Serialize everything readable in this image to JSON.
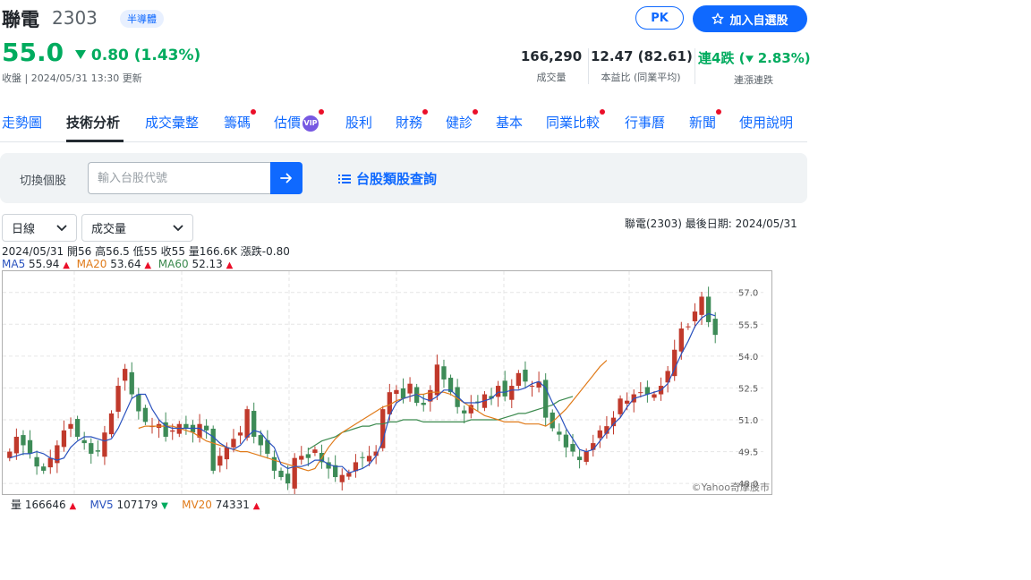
{
  "header": {
    "name": "聯電",
    "code": "2303",
    "industry": "半導體",
    "price": "55.0",
    "change": "0.80 (1.43%)",
    "meta": "收盤 | 2024/05/31 13:30 更新",
    "pk_label": "PK",
    "watchlist_label": "加入自選股"
  },
  "stats": [
    {
      "value": "166,290",
      "label": "成交量"
    },
    {
      "value": "12.47 (82.61)",
      "label": "本益比 (同業平均)"
    },
    {
      "value_prefix": "連4跌 (",
      "value_num": "2.83%",
      "value_suffix": ")",
      "label": "連漲連跌"
    }
  ],
  "tabs": [
    "走勢圖",
    "技術分析",
    "成交彙整",
    "籌碼",
    "估價",
    "股利",
    "財務",
    "健診",
    "基本",
    "同業比較",
    "行事曆",
    "新聞",
    "使用說明"
  ],
  "vip_label": "VIP",
  "search": {
    "label": "切換個股",
    "placeholder": "輸入台股代號",
    "category_link": "台股類股查詢"
  },
  "controls": {
    "period": "日線",
    "indicator": "成交量",
    "last_date": "聯電(2303)   最後日期: 2024/05/31"
  },
  "ohlc_text": "2024/05/31 開56 高56.5 低55 收55 量166.6K 漲跌-0.80",
  "ma": [
    {
      "label": "MA5",
      "value": "55.94",
      "color": "#2a52be"
    },
    {
      "label": "MA20",
      "value": "53.64",
      "color": "#e07b1a"
    },
    {
      "label": "MA60",
      "value": "52.13",
      "color": "#3b8a4e"
    }
  ],
  "volume": [
    {
      "label": "量",
      "value": "166646",
      "dir": "up",
      "color": "#232a31"
    },
    {
      "label": "MV5",
      "value": "107179",
      "dir": "down",
      "color": "#2a52be"
    },
    {
      "label": "MV20",
      "value": "74331",
      "dir": "up",
      "color": "#e07b1a"
    }
  ],
  "colors": {
    "accent": "#0f69ff",
    "up": "#eb0f29",
    "down": "#00ab5e",
    "candle_up": "#c0392b",
    "candle_down": "#3d8b57"
  },
  "chart_data": {
    "type": "candlestick",
    "y_ticks": [
      "57.0",
      "55.5",
      "54.0",
      "52.5",
      "51.0",
      "49.5",
      "48.0"
    ],
    "ylim": [
      47.5,
      58.0
    ],
    "watermark": "©Yahoo奇摩股市",
    "closes": [
      49.5,
      50.2,
      49.8,
      49.4,
      48.8,
      48.6,
      49.2,
      49.8,
      50.5,
      50.8,
      50.2,
      49.9,
      49.4,
      49.5,
      50.4,
      51.3,
      52.6,
      53.4,
      52.2,
      51.4,
      50.9,
      50.7,
      50.8,
      50.2,
      50.5,
      50.8,
      50.6,
      50.4,
      50.8,
      50.5,
      48.6,
      49.3,
      49.7,
      50.1,
      50.4,
      51.5,
      50.2,
      49.8,
      49.4,
      48.6,
      48.3,
      48.0,
      49.2,
      49.3,
      49.2,
      49.6,
      49.0,
      48.7,
      48.3,
      48.4,
      48.5,
      49.0,
      49.2,
      49.3,
      49.5,
      51.5,
      52.3,
      52.4,
      52.0,
      52.7,
      51.8,
      51.7,
      52.4,
      53.6,
      52.9,
      52.3,
      51.6,
      51.3,
      51.7,
      51.8,
      52.2,
      52.0,
      52.6,
      52.1,
      52.6,
      53.2,
      52.8,
      52.6,
      52.8,
      51.1,
      50.6,
      50.3,
      49.7,
      49.5,
      49.1,
      49.5,
      49.9,
      50.5,
      50.7,
      51.1,
      52.0,
      51.9,
      52.2,
      52.3,
      52.2,
      52.2,
      52.6,
      53.3,
      54.3,
      55.3,
      55.4,
      56.1,
      56.8,
      55.6,
      55.0
    ],
    "ma5": [
      49.2,
      49.3,
      49.4,
      49.4,
      49.5,
      49.4,
      49.2,
      49.1,
      49.2,
      49.7,
      50.0,
      50.2,
      50.2,
      50.1,
      50.0,
      50.1,
      50.6,
      51.3,
      52.0,
      52.2,
      52.2,
      51.5,
      51.0,
      50.7,
      50.6,
      50.6,
      50.6,
      50.6,
      50.6,
      50.4,
      50.2,
      49.9,
      49.7,
      49.6,
      49.8,
      50.2,
      50.5,
      50.4,
      50.0,
      49.7,
      48.9,
      48.7,
      48.8,
      48.8,
      48.9,
      49.1,
      49.1,
      48.9,
      48.8,
      48.8,
      48.5,
      48.6,
      48.7,
      48.9,
      49.3,
      50.0,
      51.2,
      51.8,
      52.0,
      52.1,
      52.2,
      52.0,
      51.9,
      52.1,
      52.4,
      52.4,
      52.1,
      51.8,
      51.8,
      51.8,
      51.9,
      52.0,
      52.3,
      52.3,
      52.4,
      52.4,
      52.5,
      52.7,
      52.8,
      52.5,
      51.8,
      51.3,
      50.6,
      50.1,
      49.6,
      49.5,
      49.6,
      50.0,
      50.4,
      50.8,
      51.1,
      51.6,
      52.0,
      52.1,
      52.2,
      52.3,
      52.4,
      52.7,
      53.4,
      54.1,
      54.7,
      55.4,
      55.8,
      56.0,
      55.9
    ],
    "ma20": [
      null,
      null,
      null,
      null,
      null,
      null,
      null,
      null,
      null,
      null,
      null,
      null,
      null,
      null,
      null,
      null,
      null,
      null,
      null,
      50.6,
      50.7,
      50.7,
      50.7,
      50.7,
      50.7,
      50.6,
      50.5,
      50.4,
      50.2,
      50.0,
      49.9,
      49.8,
      49.7,
      49.6,
      49.5,
      49.5,
      49.4,
      49.3,
      49.2,
      49.1,
      49.0,
      48.9,
      48.8,
      48.7,
      48.6,
      48.7,
      49.2,
      49.7,
      50.1,
      50.4,
      50.6,
      50.8,
      51.0,
      51.2,
      51.4,
      51.6,
      51.7,
      51.9,
      52.0,
      52.1,
      52.2,
      52.2,
      52.3,
      52.3,
      52.3,
      52.2,
      52.0,
      51.8,
      51.6,
      51.4,
      51.2,
      51.1,
      51.0,
      50.9,
      50.9,
      50.9,
      50.8,
      50.8,
      50.8,
      50.7,
      50.9,
      51.2,
      51.5,
      51.9,
      52.3,
      52.7,
      53.1,
      53.5,
      53.8
    ],
    "ma60": [
      null,
      null,
      null,
      null,
      null,
      null,
      null,
      null,
      null,
      null,
      null,
      null,
      null,
      null,
      null,
      null,
      null,
      null,
      null,
      null,
      null,
      null,
      null,
      null,
      null,
      null,
      null,
      null,
      null,
      null,
      null,
      null,
      null,
      null,
      null,
      null,
      null,
      null,
      null,
      null,
      null,
      null,
      null,
      null,
      49.6,
      49.8,
      50.0,
      50.1,
      50.2,
      50.4,
      50.5,
      50.6,
      50.7,
      50.7,
      50.8,
      50.8,
      50.9,
      50.9,
      51.0,
      51.0,
      51.0,
      50.9,
      50.9,
      50.9,
      50.9,
      50.9,
      50.9,
      50.9,
      51.0,
      51.0,
      51.0,
      51.0,
      51.0,
      51.1,
      51.2,
      51.3,
      51.3,
      51.4,
      51.5,
      51.6,
      51.7,
      51.9,
      52.0,
      52.1
    ]
  }
}
